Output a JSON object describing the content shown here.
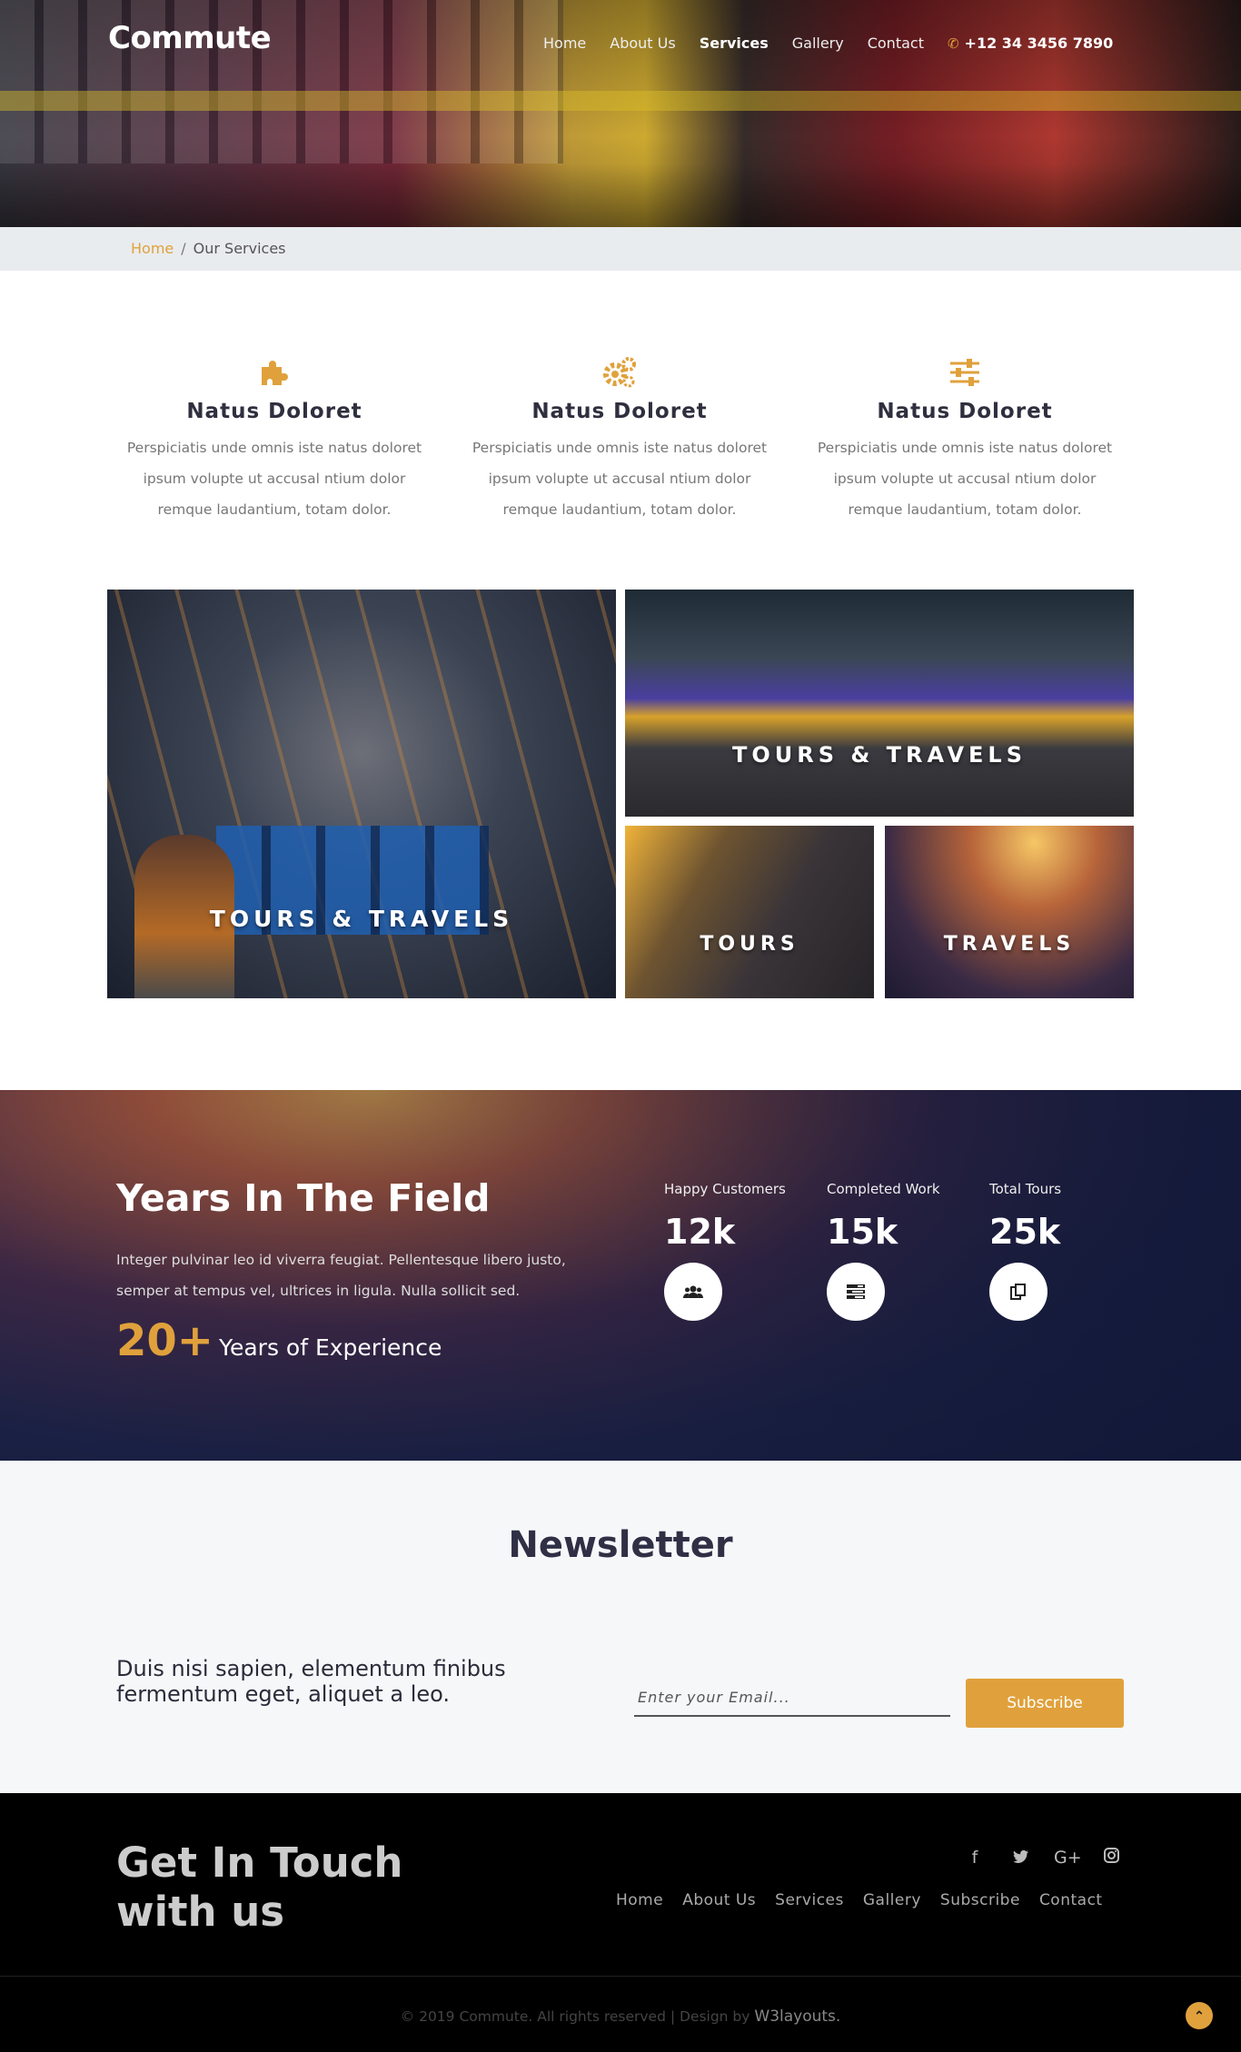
{
  "header": {
    "logo": "Commute",
    "nav": [
      "Home",
      "About Us",
      "Services",
      "Gallery",
      "Contact"
    ],
    "active_nav": "Services",
    "phone": "+12 34 3456 7890"
  },
  "breadcrumb": {
    "home": "Home",
    "separator": "/",
    "current": "Our Services"
  },
  "features": [
    {
      "icon": "puzzle-icon",
      "title": "Natus Doloret",
      "text": "Perspiciatis unde omnis iste natus doloret ipsum volupte ut accusal ntium dolor remque laudantium, totam dolor."
    },
    {
      "icon": "gears-icon",
      "title": "Natus Doloret",
      "text": "Perspiciatis unde omnis iste natus doloret ipsum volupte ut accusal ntium dolor remque laudantium, totam dolor."
    },
    {
      "icon": "sliders-icon",
      "title": "Natus Doloret",
      "text": "Perspiciatis unde omnis iste natus doloret ipsum volupte ut accusal ntium dolor remque laudantium, totam dolor."
    }
  ],
  "gallery": [
    {
      "label": "TOURS & TRAVELS"
    },
    {
      "label": "TOURS & TRAVELS"
    },
    {
      "label": "TOURS"
    },
    {
      "label": "TRAVELS"
    }
  ],
  "stats": {
    "title": "Years In The Field",
    "description": "Integer pulvinar leo id viverra feugiat. Pellentesque libero justo, semper at tempus vel, ultrices in ligula. Nulla sollicit sed.",
    "exp_number": "20+",
    "exp_text": "Years of Experience",
    "items": [
      {
        "caption": "Happy Customers",
        "value": "12k",
        "icon": "users-icon"
      },
      {
        "caption": "Completed Work",
        "value": "15k",
        "icon": "tasks-icon"
      },
      {
        "caption": "Total Tours",
        "value": "25k",
        "icon": "copy-icon"
      }
    ]
  },
  "newsletter": {
    "title": "Newsletter",
    "blurb": "Duis nisi sapien, elementum finibus fermentum eget, aliquet a leo.",
    "email_placeholder": "Enter your Email...",
    "subscribe": "Subscribe"
  },
  "footer": {
    "title": "Get In Touch with us",
    "social": [
      "f",
      "t",
      "G+",
      "ig"
    ],
    "nav": [
      "Home",
      "About Us",
      "Services",
      "Gallery",
      "Subscribe",
      "Contact"
    ],
    "copyright": "© 2019 Commute. All rights reserved | Design by",
    "designer": "W3layouts."
  },
  "colors": {
    "accent": "#e0a13c",
    "dark": "#2f2f45",
    "footer": "#000000"
  }
}
